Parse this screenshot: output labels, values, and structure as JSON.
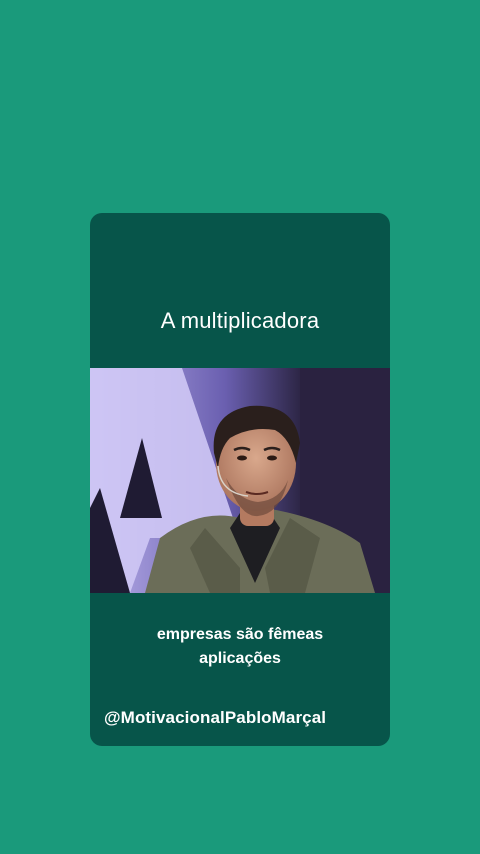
{
  "card": {
    "title": "A multiplicadora",
    "caption_line1": "empresas são fêmeas",
    "caption_line2": "aplicações",
    "handle": "@MotivacionalPabloMarçal"
  },
  "video": {
    "content": "speaker-on-stage"
  },
  "colors": {
    "background": "#1a9a7b",
    "card": "#07554a",
    "text": "#ffffff"
  }
}
